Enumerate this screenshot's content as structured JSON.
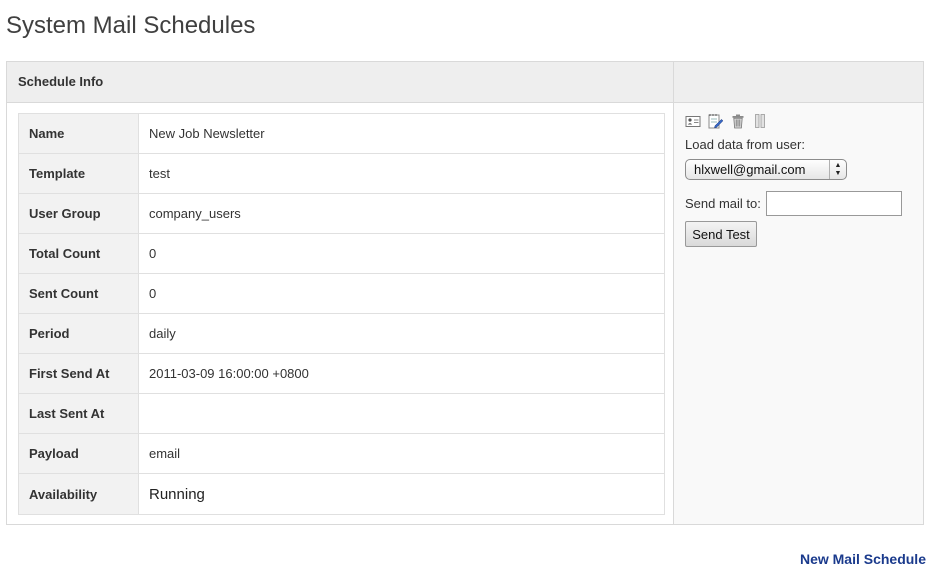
{
  "page": {
    "title": "System Mail Schedules"
  },
  "panel": {
    "header_title": "Schedule Info"
  },
  "schedule_info": [
    {
      "label": "Name",
      "value": "New Job Newsletter"
    },
    {
      "label": "Template",
      "value": "test"
    },
    {
      "label": "User Group",
      "value": "company_users"
    },
    {
      "label": "Total Count",
      "value": "0"
    },
    {
      "label": "Sent Count",
      "value": "0"
    },
    {
      "label": "Period",
      "value": "daily"
    },
    {
      "label": "First Send At",
      "value": "2011-03-09 16:00:00 +0800"
    },
    {
      "label": "Last Sent At",
      "value": ""
    },
    {
      "label": "Payload",
      "value": "email"
    },
    {
      "label": "Availability",
      "value": "Running"
    }
  ],
  "actions": {
    "icons": [
      "vcard-icon",
      "edit-icon",
      "trash-icon",
      "pause-icon"
    ]
  },
  "test_panel": {
    "load_label": "Load data from user:",
    "selected_user": "hlxwell@gmail.com",
    "send_to_label": "Send mail to:",
    "send_to_value": "",
    "send_button": "Send Test"
  },
  "footer": {
    "new_link": "New Mail Schedule"
  }
}
